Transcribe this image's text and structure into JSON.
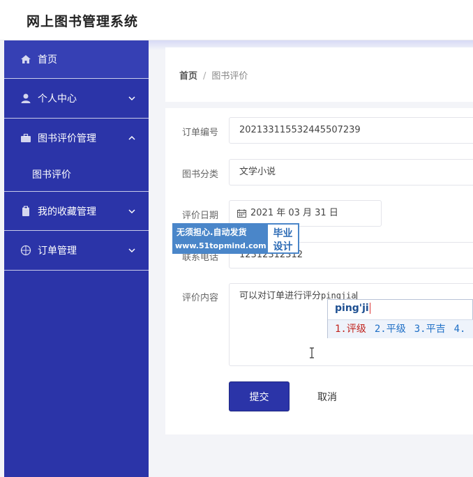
{
  "app": {
    "title": "网上图书管理系统"
  },
  "sidebar": {
    "items": [
      {
        "label": "首页",
        "icon": "home-icon"
      },
      {
        "label": "个人中心",
        "icon": "user-icon",
        "expanded": false
      },
      {
        "label": "图书评价管理",
        "icon": "briefcase-icon",
        "expanded": true,
        "children": [
          {
            "label": "图书评价"
          }
        ]
      },
      {
        "label": "我的收藏管理",
        "icon": "clipboard-icon",
        "expanded": false
      },
      {
        "label": "订单管理",
        "icon": "crosshair-icon",
        "expanded": false
      }
    ]
  },
  "breadcrumb": {
    "home": "首页",
    "separator": "/",
    "current": "图书评价"
  },
  "form": {
    "order_no": {
      "label": "订单编号",
      "value": "20213311553244550723​9"
    },
    "category": {
      "label": "图书分类",
      "value": "文学小说"
    },
    "date": {
      "label": "评价日期",
      "value": "2021 年 03 月 31 日"
    },
    "phone": {
      "label": "联系电话",
      "value": "12312312312"
    },
    "content": {
      "label": "评价内容",
      "value": "可以对订单进行评分",
      "composing": "pingjia"
    }
  },
  "ime": {
    "composition": "ping'ji",
    "candidates": [
      "1.评级",
      "2.平级",
      "3.平吉",
      "4."
    ]
  },
  "buttons": {
    "submit": "提交",
    "cancel": "取消"
  },
  "watermark": {
    "line1": "无须担心.自动发货",
    "line2": "www.51topmind.com",
    "badge1": "毕业",
    "badge2": "设计"
  },
  "colors": {
    "primary": "#2b34a8",
    "watermark": "#4a86c9"
  }
}
